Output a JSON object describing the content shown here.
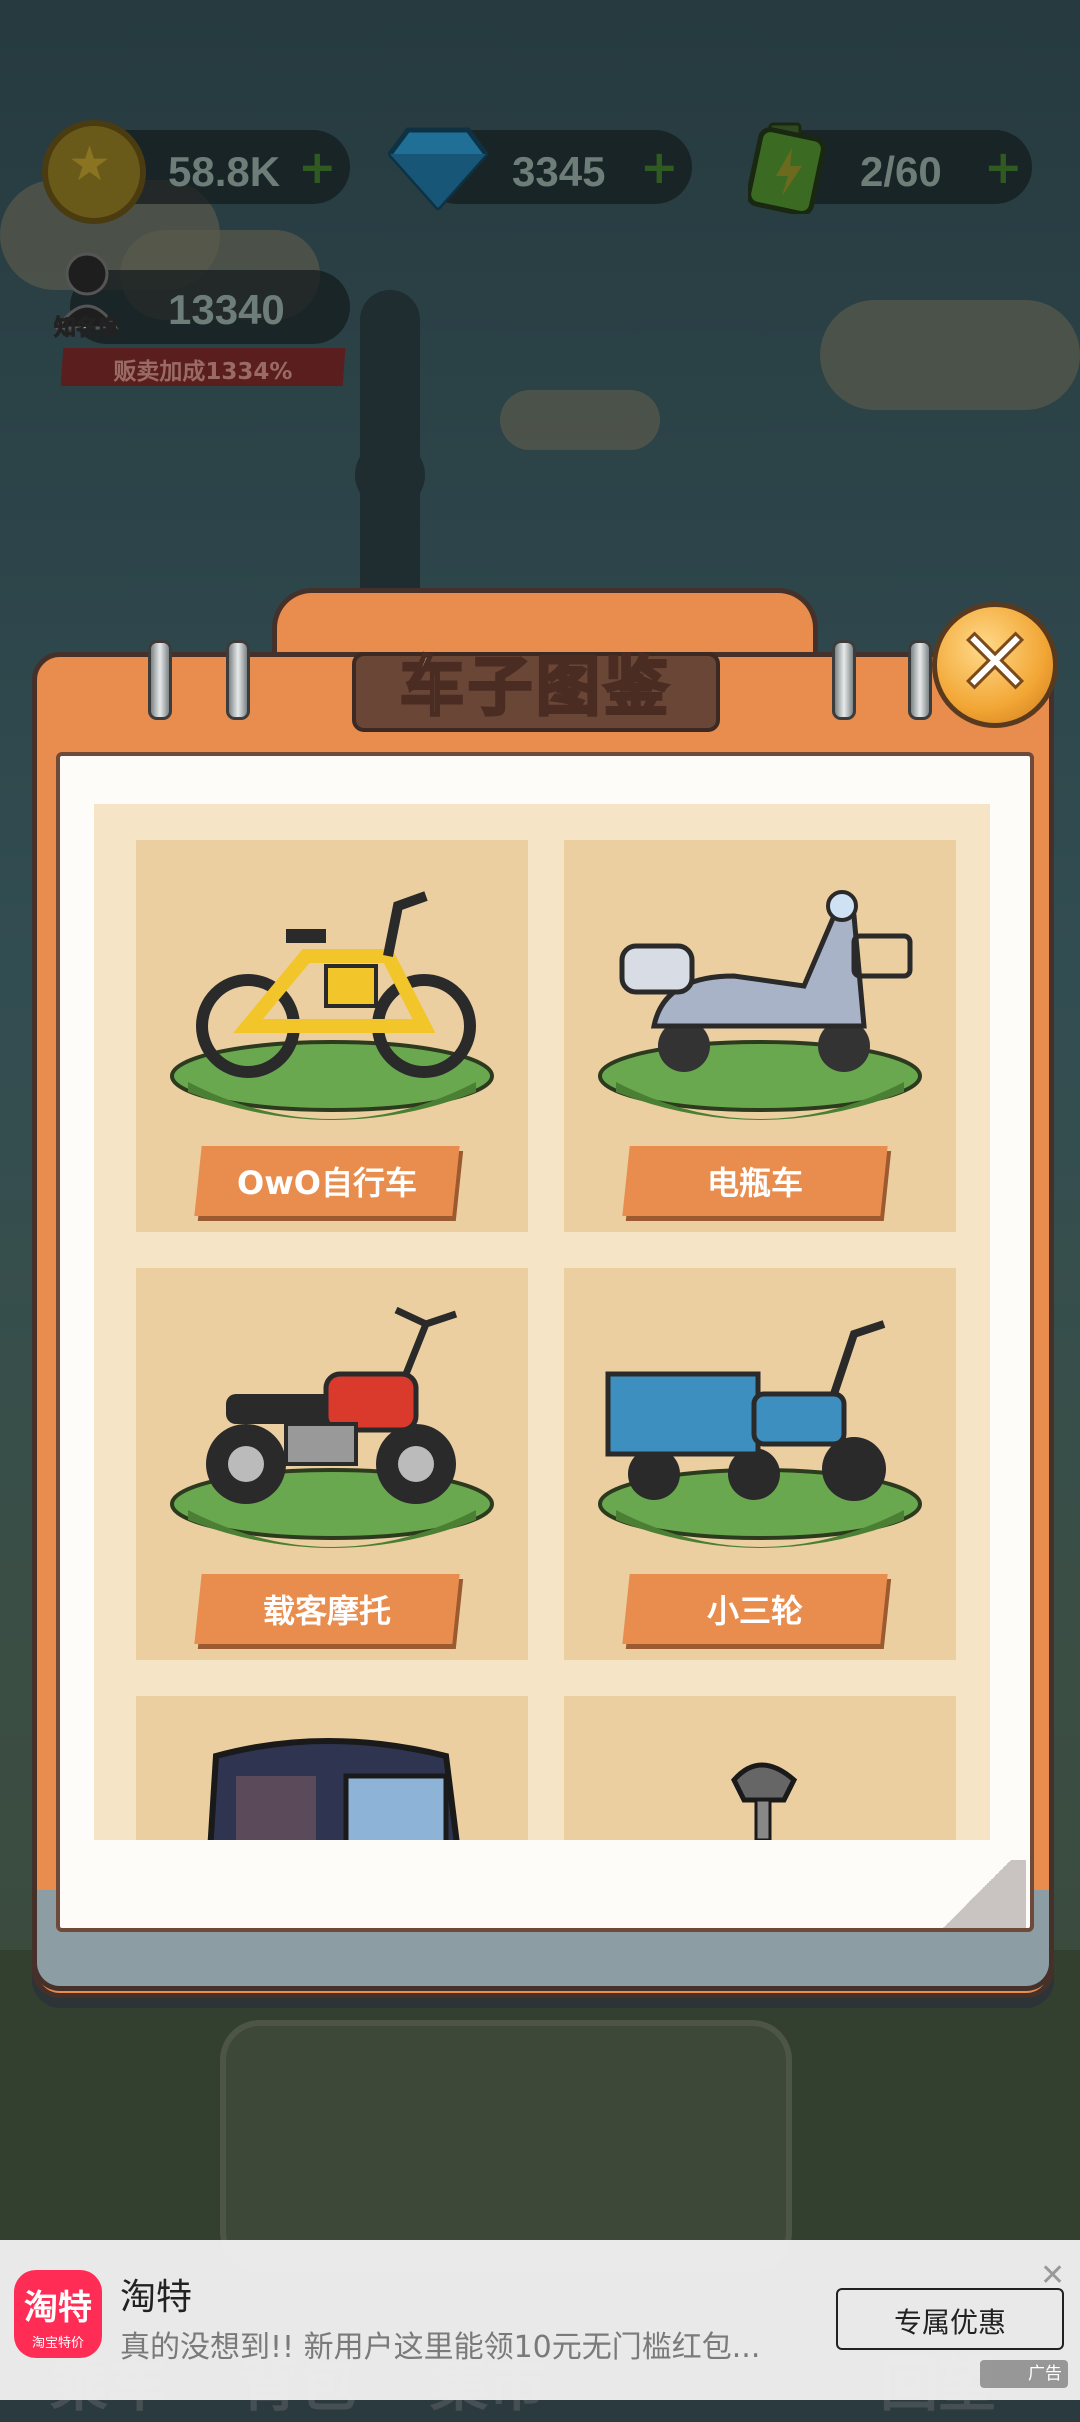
{
  "hud": {
    "coins": "58.8K",
    "gems": "3345",
    "energy": "2/60",
    "fame": "13340",
    "fame_label": "知名度",
    "fame_bonus": "贩卖加成1334%"
  },
  "panel": {
    "title": "车子图鉴",
    "close_icon": "close-x"
  },
  "vehicles": [
    {
      "name": "OwO自行车",
      "color": "#f2c52b"
    },
    {
      "name": "电瓶车",
      "color": "#a9b3c7"
    },
    {
      "name": "载客摩托",
      "color": "#d93a2b"
    },
    {
      "name": "小三轮",
      "color": "#3d8fbf"
    },
    {
      "name": "",
      "color": "#2f3550"
    },
    {
      "name": "",
      "color": "#555"
    }
  ],
  "ad": {
    "logo_main": "淘特",
    "logo_sub": "淘宝特价",
    "title": "淘特",
    "description": "真的没想到!! 新用户这里能领10元无门槛红包...",
    "button": "专属优惠",
    "tag": "广告"
  }
}
